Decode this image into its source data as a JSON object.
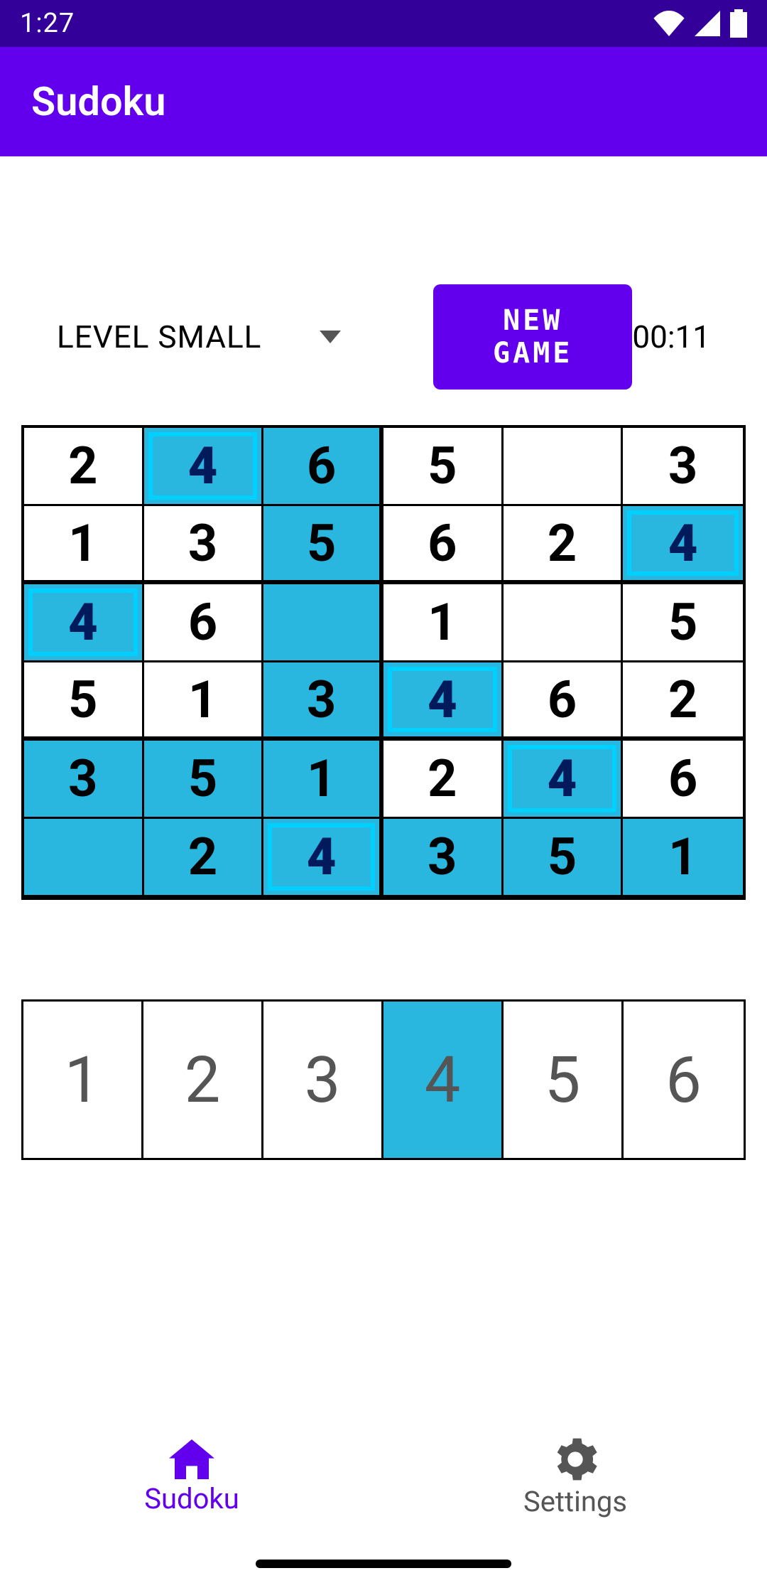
{
  "status": {
    "time": "1:27"
  },
  "appbar": {
    "title": "Sudoku"
  },
  "controls": {
    "level_label": "LEVEL SMALL",
    "new_game_label": "NEW GAME",
    "timer": "00:11"
  },
  "grid": [
    [
      {
        "v": "2",
        "s": "open"
      },
      {
        "v": "4",
        "s": "user"
      },
      {
        "v": "6",
        "s": "fill"
      },
      {
        "v": "5",
        "s": "open"
      },
      {
        "v": "",
        "s": "open"
      },
      {
        "v": "3",
        "s": "open"
      }
    ],
    [
      {
        "v": "1",
        "s": "open"
      },
      {
        "v": "3",
        "s": "open"
      },
      {
        "v": "5",
        "s": "fill"
      },
      {
        "v": "6",
        "s": "open"
      },
      {
        "v": "2",
        "s": "open"
      },
      {
        "v": "4",
        "s": "user"
      }
    ],
    [
      {
        "v": "4",
        "s": "user"
      },
      {
        "v": "6",
        "s": "open"
      },
      {
        "v": "",
        "s": "fill"
      },
      {
        "v": "1",
        "s": "open"
      },
      {
        "v": "",
        "s": "open"
      },
      {
        "v": "5",
        "s": "open"
      }
    ],
    [
      {
        "v": "5",
        "s": "open"
      },
      {
        "v": "1",
        "s": "open"
      },
      {
        "v": "3",
        "s": "fill"
      },
      {
        "v": "4",
        "s": "user"
      },
      {
        "v": "6",
        "s": "open"
      },
      {
        "v": "2",
        "s": "open"
      }
    ],
    [
      {
        "v": "3",
        "s": "fill"
      },
      {
        "v": "5",
        "s": "fill"
      },
      {
        "v": "1",
        "s": "fill"
      },
      {
        "v": "2",
        "s": "open"
      },
      {
        "v": "4",
        "s": "user"
      },
      {
        "v": "6",
        "s": "open"
      }
    ],
    [
      {
        "v": "",
        "s": "fill"
      },
      {
        "v": "2",
        "s": "fill"
      },
      {
        "v": "4",
        "s": "user"
      },
      {
        "v": "3",
        "s": "fill"
      },
      {
        "v": "5",
        "s": "fill"
      },
      {
        "v": "1",
        "s": "fill"
      }
    ]
  ],
  "numpad": [
    {
      "label": "1",
      "selected": false
    },
    {
      "label": "2",
      "selected": false
    },
    {
      "label": "3",
      "selected": false
    },
    {
      "label": "4",
      "selected": true
    },
    {
      "label": "5",
      "selected": false
    },
    {
      "label": "6",
      "selected": false
    }
  ],
  "nav": {
    "sudoku": "Sudoku",
    "settings": "Settings"
  }
}
